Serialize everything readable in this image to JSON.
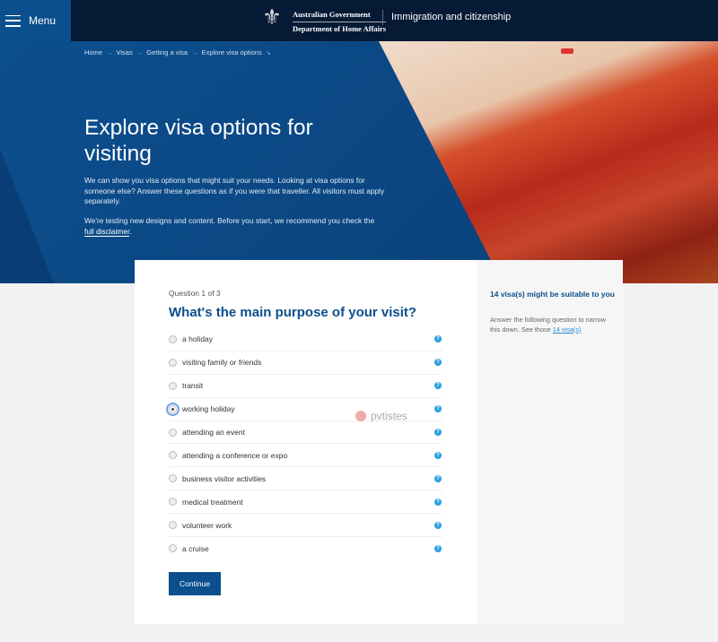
{
  "header": {
    "menu_label": "Menu",
    "gov_line1": "Australian Government",
    "gov_line2": "Department of Home Affairs",
    "site_title": "Immigration and citizenship"
  },
  "breadcrumb": [
    "Home",
    "Visas",
    "Getting a visa",
    "Explore visa options"
  ],
  "hero": {
    "title": "Explore visa options for visiting",
    "intro": "We can show you visa options that might suit your needs. Looking at visa options for someone else? Answer these questions as if you were that traveller. All visitors must apply separately.",
    "disclaimer_before": "We're testing new designs and content. Before you start, we recommend you check the ",
    "disclaimer_link": "full disclaimer",
    "disclaimer_after": "."
  },
  "question": {
    "number": "Question 1 of 3",
    "title": "What's the main purpose of your visit?",
    "selected": "working holiday",
    "options": [
      "a holiday",
      "visiting family or friends",
      "transit",
      "working holiday",
      "attending an event",
      "attending a conference or expo",
      "business visitor activities",
      "medical treatment",
      "volunteer work",
      "a cruise"
    ],
    "continue_label": "Continue"
  },
  "sidebar": {
    "heading": "14 visa(s) might be suitable to you",
    "text": "Answer the following question to narrow this down. See those ",
    "link": "14 visa(s)"
  },
  "watermark": "pvtistes",
  "colors": {
    "navy": "#061a36",
    "primary": "#0b4f8c",
    "link": "#2a8fd8"
  }
}
